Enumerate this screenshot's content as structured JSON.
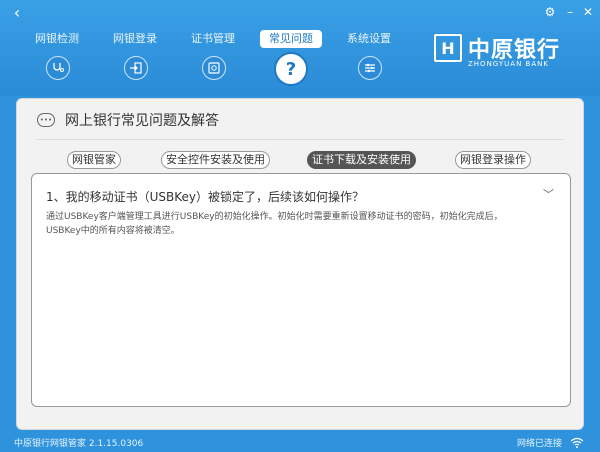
{
  "window": {
    "back_icon": "back-icon",
    "settings_icon": "gear-icon",
    "minimize_icon": "minimize-icon",
    "close_icon": "close-icon"
  },
  "nav": {
    "items": [
      {
        "label": "网银检测",
        "icon": "stethoscope-icon"
      },
      {
        "label": "网银登录",
        "icon": "login-icon"
      },
      {
        "label": "证书管理",
        "icon": "certificate-icon"
      },
      {
        "label": "常见问题",
        "icon": "question-icon",
        "active": true
      },
      {
        "label": "系统设置",
        "icon": "settings-icon"
      }
    ]
  },
  "brand": {
    "name": "中原银行",
    "sub": "ZHONGYUAN BANK"
  },
  "faq": {
    "title": "网上银行常见问题及解答",
    "tabs": [
      {
        "label": "网银管家"
      },
      {
        "label": "安全控件安装及使用"
      },
      {
        "label": "证书下载及安装使用",
        "active": true
      },
      {
        "label": "网银登录操作"
      }
    ],
    "question": "1、我的移动证书（USBKey）被锁定了，后续该如何操作？",
    "answer": "通过USBKey客户端管理工具进行USBKey的初始化操作。初始化时需要重新设置移动证书的密码，初始化完成后，USBKey中的所有内容将被清空。"
  },
  "status": {
    "version": "中原银行网银管家 2.1.15.0306",
    "network": "网络已连接"
  },
  "colors": {
    "primary": "#2e93dc",
    "active_tab": "#555555"
  }
}
